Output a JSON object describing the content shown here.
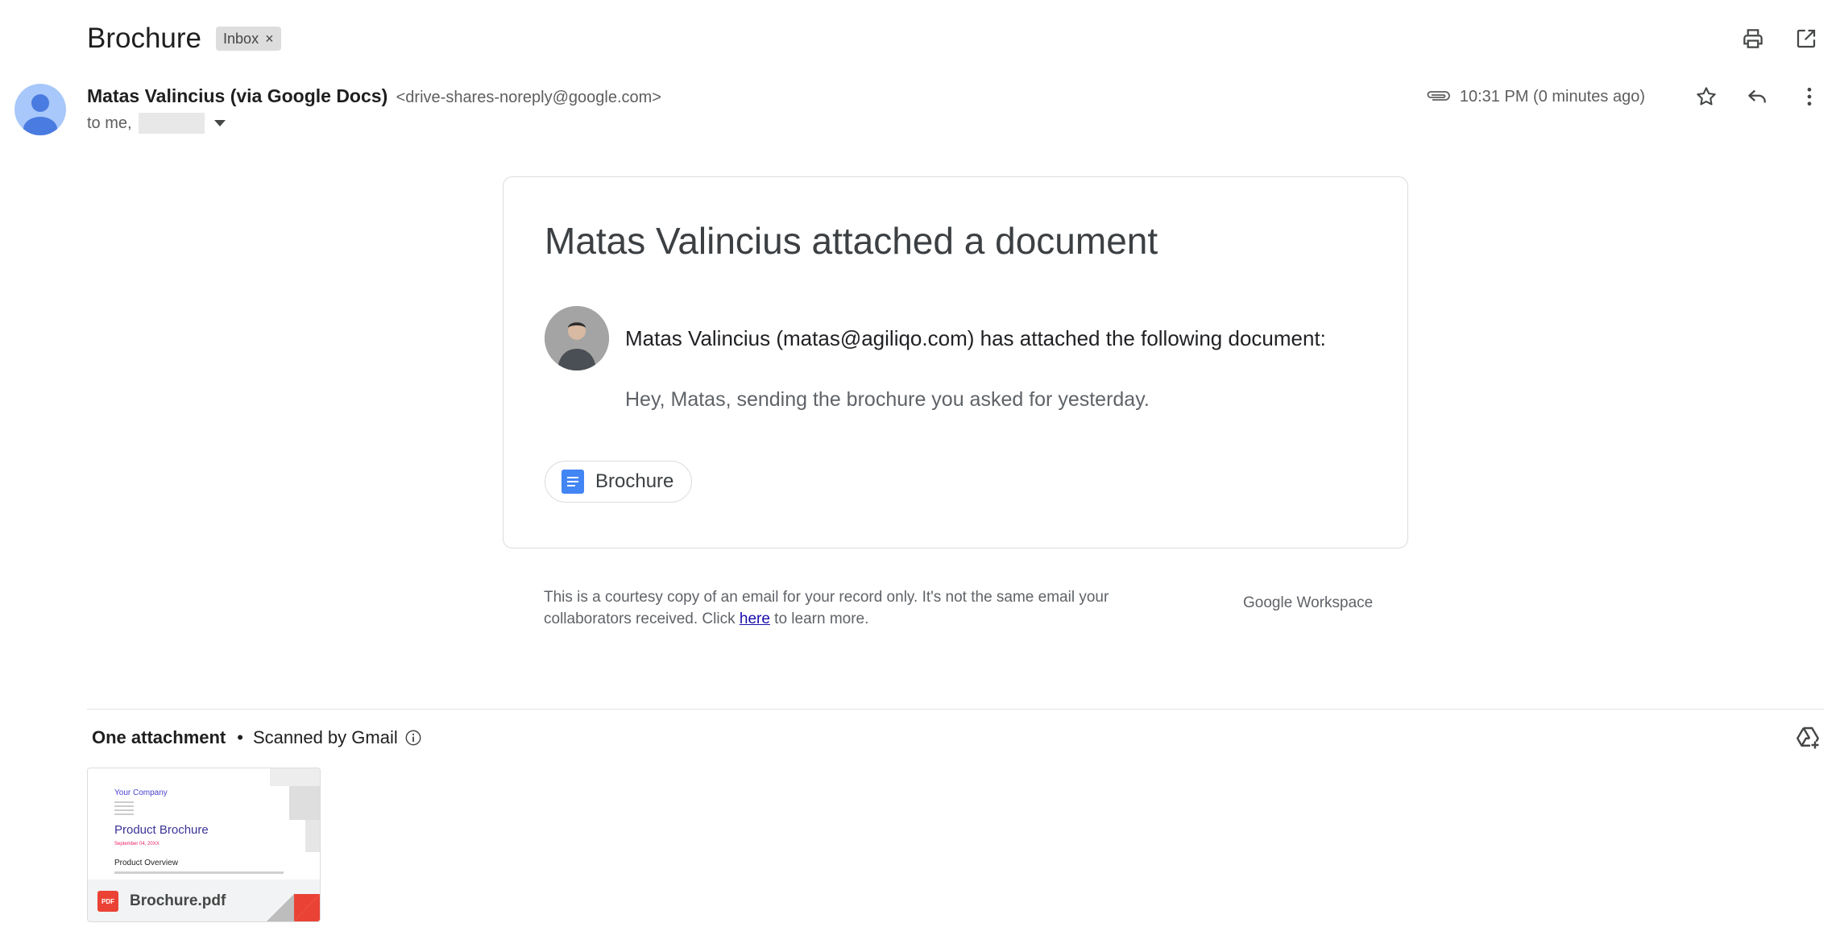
{
  "email": {
    "subject": "Brochure",
    "label": "Inbox",
    "label_remove": "×",
    "sender_name": "Matas Valincius (via Google Docs)",
    "sender_email": "<drive-shares-noreply@google.com>",
    "to_prefix": "to me,",
    "timestamp": "10:31 PM (0 minutes ago)"
  },
  "card": {
    "title": "Matas Valincius attached a document",
    "line": "Matas Valincius (matas@agiliqo.com) has attached the following document:",
    "message": "Hey, Matas, sending the brochure you asked for yesterday.",
    "doc_chip_label": "Brochure"
  },
  "footer": {
    "courtesy_before": "This is a courtesy copy of an email for your record only. It's not the same email your collaborators received. Click ",
    "courtesy_link": "here",
    "courtesy_after": " to learn more.",
    "workspace_google": "Google",
    "workspace_word": " Workspace"
  },
  "attachments": {
    "count_label": "One attachment",
    "separator": "•",
    "scanned_label": "Scanned by Gmail",
    "file_name": "Brochure.pdf",
    "file_badge": "PDF",
    "thumbnail": {
      "company": "Your Company",
      "title": "Product Brochure",
      "date": "September 04, 20XX",
      "section": "Product Overview"
    }
  },
  "icons": {
    "top": [
      "print-icon",
      "open-in-new-window-icon"
    ],
    "meta": [
      "paperclip-icon",
      "star-icon",
      "reply-icon",
      "more-vert-icon"
    ],
    "attachments": [
      "info-icon",
      "add-to-drive-icon",
      "pdf-icon"
    ]
  },
  "colors": {
    "link": "#1a0dab",
    "doc_blue": "#4285f4",
    "pdf_red": "#ea4335",
    "avatar_bg": "#a8c7fa"
  }
}
